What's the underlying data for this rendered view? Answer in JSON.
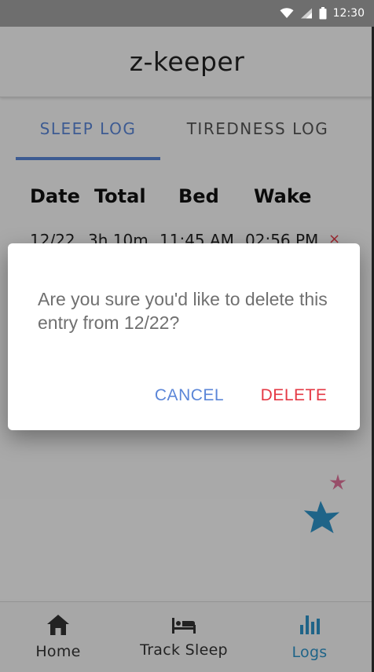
{
  "status_bar": {
    "time": "12:30",
    "icons": [
      "wifi-icon",
      "cell-signal-icon",
      "battery-icon"
    ]
  },
  "app": {
    "title": "z-keeper"
  },
  "tabs": [
    {
      "label": "SLEEP LOG",
      "active": true
    },
    {
      "label": "TIREDNESS LOG",
      "active": false
    }
  ],
  "log_table": {
    "headers": [
      "Date",
      "Total",
      "Bed",
      "Wake"
    ],
    "rows": [
      {
        "date": "12/22",
        "total": "3h 10m",
        "bed": "11:45 AM",
        "wake": "02:56 PM",
        "delete": "×"
      }
    ]
  },
  "dialog": {
    "message": "Are you sure you'd like to delete this entry from 12/22?",
    "cancel_label": "CANCEL",
    "delete_label": "DELETE"
  },
  "bottom_nav": {
    "items": [
      {
        "label": "Home",
        "icon": "home-icon",
        "active": false
      },
      {
        "label": "Track Sleep",
        "icon": "bed-icon",
        "active": false
      },
      {
        "label": "Logs",
        "icon": "bar-chart-icon",
        "active": true
      }
    ]
  },
  "colors": {
    "accent": "#5b86d8",
    "danger": "#e53945",
    "nav_active": "#2f94c9",
    "star_pink": "#e0739b",
    "star_blue": "#2f94c9"
  }
}
